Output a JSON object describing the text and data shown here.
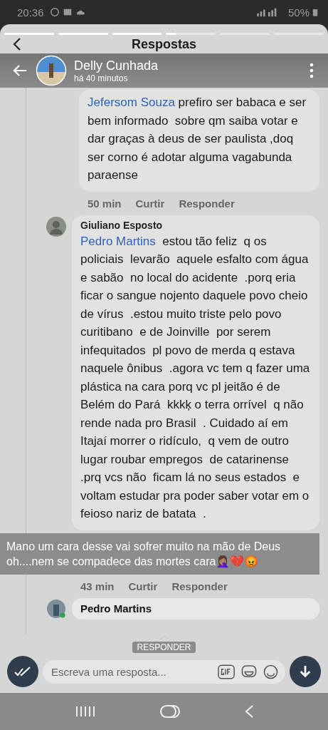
{
  "status_bar": {
    "time": "20:36",
    "battery": "50%"
  },
  "story": {
    "segments": [
      {
        "level": 1
      },
      {
        "level": 1
      },
      {
        "level": 1
      },
      {
        "level": 0.2
      },
      {
        "level": 0
      },
      {
        "level": 0
      }
    ],
    "author": "Delly Cunhada",
    "time": "há 40 minutos",
    "caption": "Mano um cara desse vai sofrer muito na mão de Deus oh....nem se compadece das mortes cara🤦🏽‍♀️💔😡",
    "reply_hint": "RESPONDER"
  },
  "header": {
    "title": "Respostas"
  },
  "comments": [
    {
      "mention": "Jefersom Souza",
      "text": " prefiro ser babaca e ser bem informado  sobre qm saiba votar e dar graças à deus de ser paulista ,doq  ser corno é adotar alguma vagabunda paraense",
      "time": "50 min",
      "actions": [
        "Curtir",
        "Responder"
      ]
    },
    {
      "author": "Giuliano Esposto",
      "mention": "Pedro Martins",
      "text": "  estou tão feliz  q os policiais  levarão  aquele esfalto com água e sabão  no local do acidente  .porq eria ficar o sangue nojento daquele povo cheio de vírus  .estou muito triste pelo povo curitibano  e de Joinville  por serem infequitados  pl povo de merda q estava naquele ônibus  .agora vc tem q fazer uma plástica na cara porq vc pl jeitão é de Belém do Pará  kkkķ o terra orrível  q não rende nada pro Brasil  . Cuidado aí em Itajaí morrer o ridículo,  q vem de outro lugar roubar empregos  de catarinense    .prq vcs não  ficam lá no seus estados  e voltam estudar pra poder saber votar em o feioso nariz de batata  .",
      "time": "43 min",
      "actions": [
        "Curtir",
        "Responder"
      ]
    }
  ],
  "next_reply": {
    "author": "Pedro Martins",
    "online": true
  },
  "composer": {
    "placeholder": "Escreva uma resposta..."
  }
}
